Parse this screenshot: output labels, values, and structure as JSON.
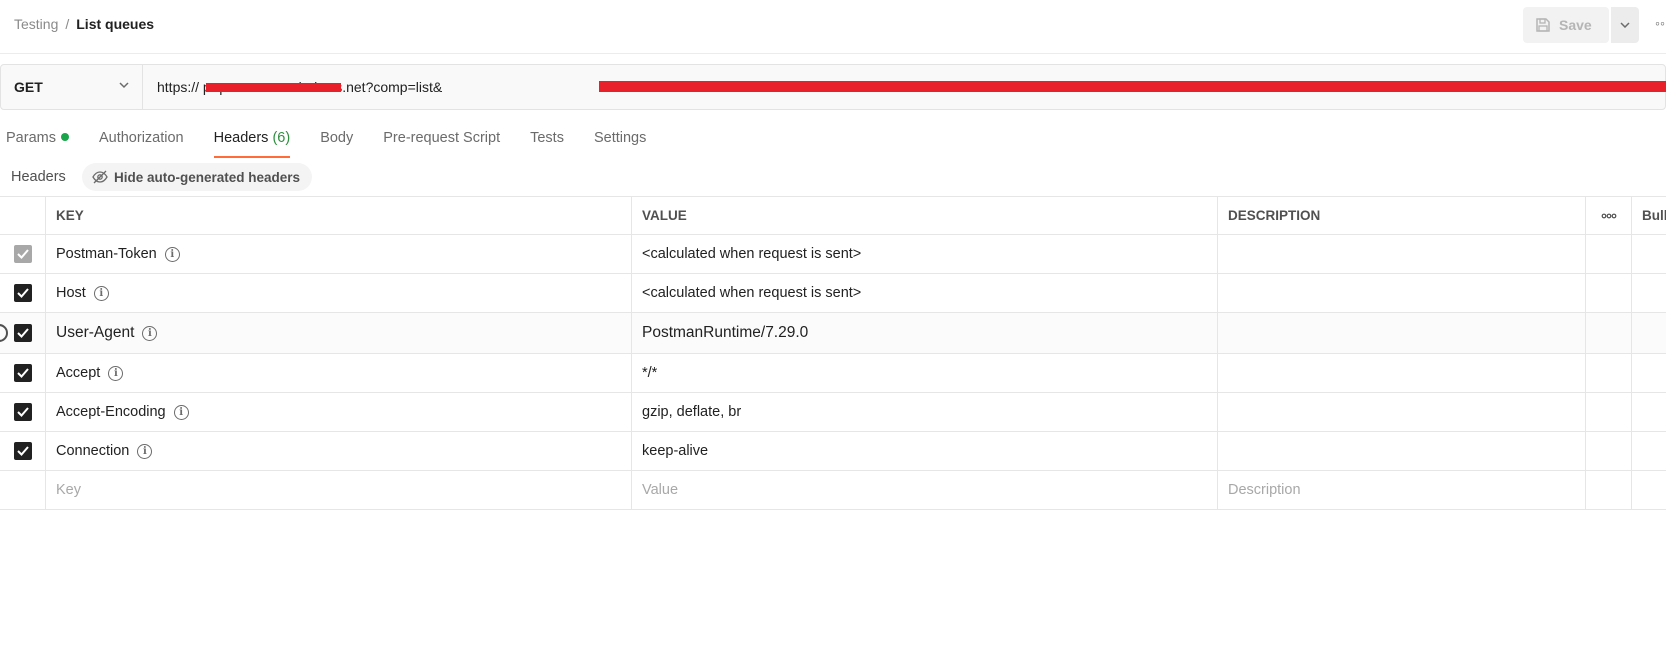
{
  "breadcrumb": {
    "parent": "Testing",
    "separator": "/",
    "current": "List queues"
  },
  "toolbar": {
    "save_label": "Save"
  },
  "request": {
    "method": "GET",
    "url": "https://                    p.queue.core.windows.net?comp=list&"
  },
  "tabs": [
    {
      "label": "Params"
    },
    {
      "label": "Authorization"
    },
    {
      "label": "Headers",
      "count": "(6)"
    },
    {
      "label": "Body"
    },
    {
      "label": "Pre-request Script"
    },
    {
      "label": "Tests"
    },
    {
      "label": "Settings"
    }
  ],
  "headers_section": {
    "label": "Headers",
    "hide_button": "Hide auto-generated headers"
  },
  "table": {
    "columns": {
      "key": "KEY",
      "value": "VALUE",
      "description": "DESCRIPTION",
      "bulk": "Bulk"
    },
    "rows": [
      {
        "key": "Postman-Token",
        "value": "<calculated when request is sent>"
      },
      {
        "key": "Host",
        "value": "<calculated when request is sent>"
      },
      {
        "key": "User-Agent",
        "value": "PostmanRuntime/7.29.0"
      },
      {
        "key": "Accept",
        "value": "*/*"
      },
      {
        "key": "Accept-Encoding",
        "value": "gzip, deflate, br"
      },
      {
        "key": "Connection",
        "value": "keep-alive"
      }
    ],
    "placeholders": {
      "key": "Key",
      "value": "Value",
      "description": "Description"
    }
  },
  "colors": {
    "accent": "#ff6c37",
    "count": "#2f8f3f",
    "status_dot": "#1aa54b",
    "redaction": "#e8202a"
  }
}
